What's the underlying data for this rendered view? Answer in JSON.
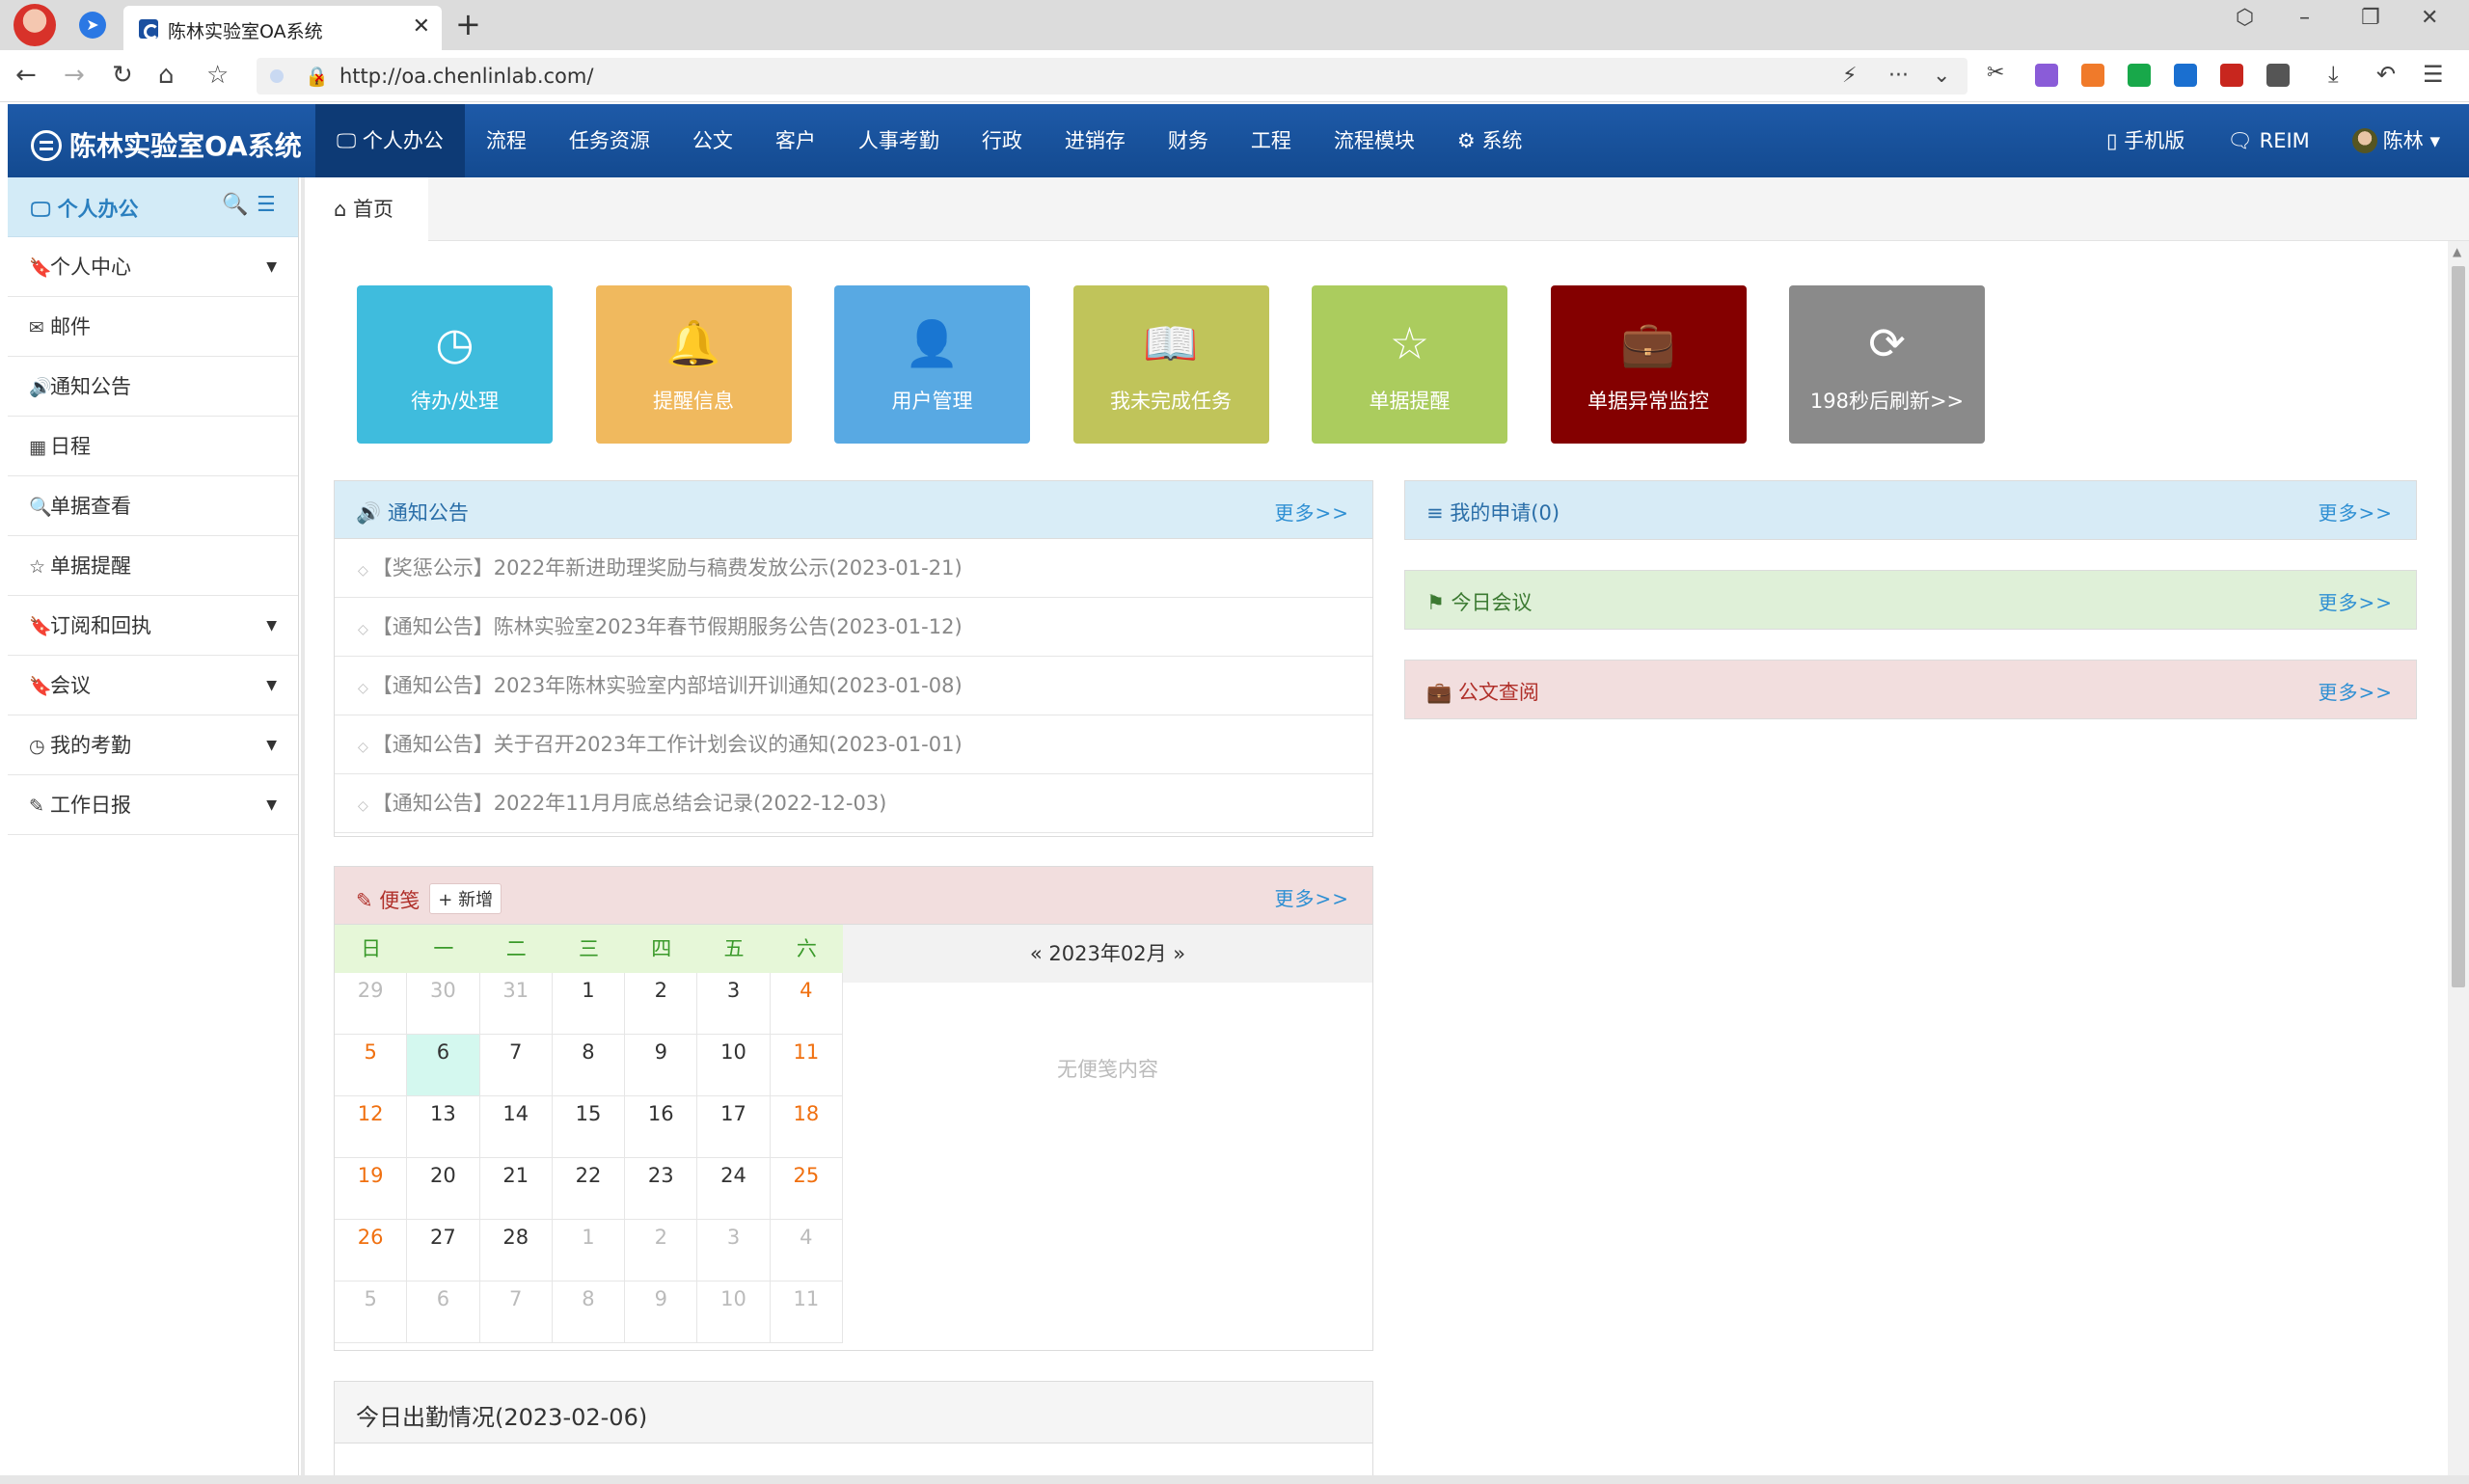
{
  "browser": {
    "tab_title": "陈林实验室OA系统",
    "url": "http://oa.chenlinlab.com/"
  },
  "navbar": {
    "brand": "陈林实验室OA系统",
    "items": [
      "个人办公",
      "流程",
      "任务资源",
      "公文",
      "客户",
      "人事考勤",
      "行政",
      "进销存",
      "财务",
      "工程",
      "流程模块",
      "系统"
    ],
    "right": {
      "mobile": "手机版",
      "reim": "REIM",
      "user": "陈林"
    }
  },
  "sidebar": {
    "title": "个人办公",
    "items": [
      {
        "label": "个人中心",
        "icon": "bookmark-icon",
        "caret": true
      },
      {
        "label": "邮件",
        "icon": "envelope-icon",
        "caret": false
      },
      {
        "label": "通知公告",
        "icon": "volume-icon",
        "caret": false
      },
      {
        "label": "日程",
        "icon": "calendar-icon",
        "caret": false
      },
      {
        "label": "单据查看",
        "icon": "search-icon",
        "caret": false
      },
      {
        "label": "单据提醒",
        "icon": "star-icon",
        "caret": false
      },
      {
        "label": "订阅和回执",
        "icon": "bookmark-icon",
        "caret": true
      },
      {
        "label": "会议",
        "icon": "bookmark-icon",
        "caret": true
      },
      {
        "label": "我的考勤",
        "icon": "clock-icon",
        "caret": true
      },
      {
        "label": "工作日报",
        "icon": "edit-icon",
        "caret": true
      }
    ]
  },
  "breadcrumb": {
    "home": "首页"
  },
  "tiles": [
    {
      "label": "待办/处理",
      "color": "#3fbcdd",
      "icon": "clock-icon"
    },
    {
      "label": "提醒信息",
      "color": "#f0b95e",
      "icon": "bell-icon"
    },
    {
      "label": "用户管理",
      "color": "#58a9e3",
      "icon": "user-icon"
    },
    {
      "label": "我未完成任务",
      "color": "#c0c45a",
      "icon": "book-icon"
    },
    {
      "label": "单据提醒",
      "color": "#abcc5e",
      "icon": "star-icon"
    },
    {
      "label": "单据异常监控",
      "color": "#840000",
      "icon": "briefcase-icon"
    },
    {
      "label": "198秒后刷新>>",
      "color": "#8a8a8a",
      "icon": "refresh-icon"
    }
  ],
  "notice_panel": {
    "title": "通知公告",
    "more": "更多>>",
    "items": [
      "【奖惩公示】2022年新进助理奖励与稿费发放公示(2023-01-21)",
      "【通知公告】陈林实验室2023年春节假期服务公告(2023-01-12)",
      "【通知公告】2023年陈林实验室内部培训开训通知(2023-01-08)",
      "【通知公告】关于召开2023年工作计划会议的通知(2023-01-01)",
      "【通知公告】2022年11月月底总结会记录(2022-12-03)"
    ]
  },
  "memo_panel": {
    "title": "便笺",
    "add": "新增",
    "more": "更多>>",
    "month_nav": "« 2023年02月 »",
    "empty": "无便笺内容",
    "weekdays": [
      "日",
      "一",
      "二",
      "三",
      "四",
      "五",
      "六"
    ],
    "weeks": [
      [
        "29",
        "30",
        "31",
        "1",
        "2",
        "3",
        "4"
      ],
      [
        "5",
        "6",
        "7",
        "8",
        "9",
        "10",
        "11"
      ],
      [
        "12",
        "13",
        "14",
        "15",
        "16",
        "17",
        "18"
      ],
      [
        "19",
        "20",
        "21",
        "22",
        "23",
        "24",
        "25"
      ],
      [
        "26",
        "27",
        "28",
        "1",
        "2",
        "3",
        "4"
      ],
      [
        "5",
        "6",
        "7",
        "8",
        "9",
        "10",
        "11"
      ]
    ],
    "today": "6"
  },
  "right_panels": [
    {
      "title": "我的申请(0)",
      "more": "更多>>",
      "bg": "#d7ebf6",
      "color": "#2a6ea8",
      "icon": "list-icon"
    },
    {
      "title": "今日会议",
      "more": "更多>>",
      "bg": "#dff0d8",
      "color": "#3c7a32",
      "icon": "flag-icon"
    },
    {
      "title": "公文查阅",
      "more": "更多>>",
      "bg": "#f2dede",
      "color": "#b0302a",
      "icon": "briefcase-icon"
    }
  ],
  "attendance": {
    "title": "今日出勤情况(2023-02-06)"
  }
}
